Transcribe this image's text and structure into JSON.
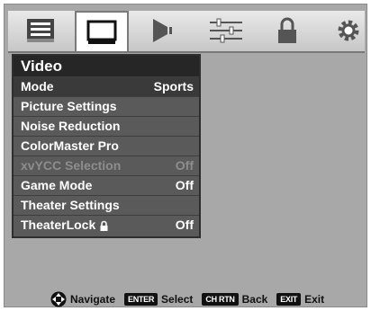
{
  "tabs": [
    {
      "icon": "setup-list-icon"
    },
    {
      "icon": "tv-screen-icon",
      "active": true
    },
    {
      "icon": "speaker-icon"
    },
    {
      "icon": "equalizer-sliders-icon"
    },
    {
      "icon": "lock-icon"
    },
    {
      "icon": "gear-icon"
    }
  ],
  "menu": {
    "title": "Video",
    "items": [
      {
        "label": "Mode",
        "value": "Sports"
      },
      {
        "label": "Picture Settings",
        "value": ""
      },
      {
        "label": "Noise Reduction",
        "value": ""
      },
      {
        "label": "ColorMaster Pro",
        "value": ""
      },
      {
        "label": "xvYCC Selection",
        "value": "Off",
        "disabled": true
      },
      {
        "label": "Game Mode",
        "value": "Off"
      },
      {
        "label": "Theater Settings",
        "value": ""
      },
      {
        "label": "TheaterLock",
        "value": "Off",
        "icon": "lock-icon"
      }
    ]
  },
  "footer": {
    "navigate": "Navigate",
    "enter_key": "ENTER",
    "select": "Select",
    "back_key": "CH RTN",
    "back": "Back",
    "exit_key": "EXIT",
    "exit": "Exit"
  }
}
